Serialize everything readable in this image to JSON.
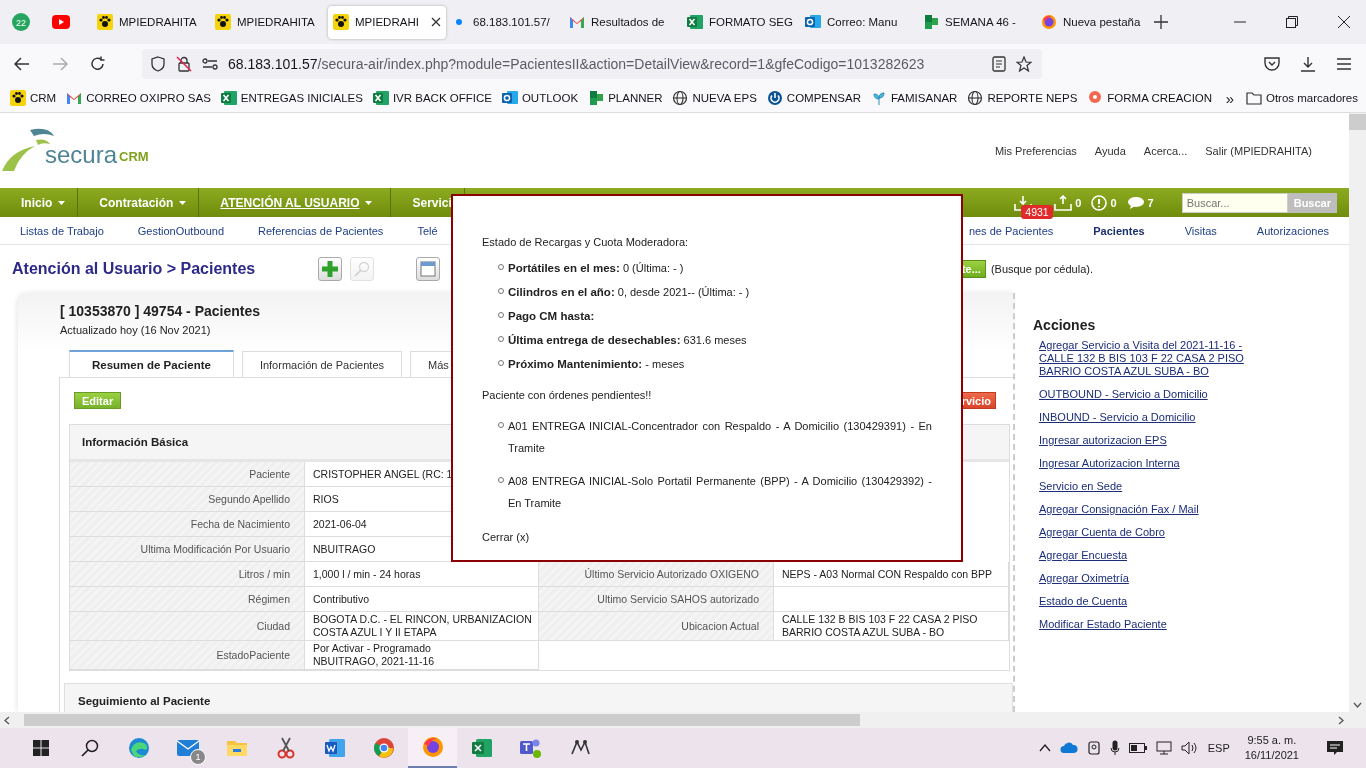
{
  "browser": {
    "pinned_badge": "22",
    "tabs": [
      {
        "title": "MPIEDRAHITA",
        "selected": false
      },
      {
        "title": "MPIEDRAHITA",
        "selected": false
      },
      {
        "title": "MPIEDRAHI",
        "selected": true
      },
      {
        "title": "68.183.101.57/",
        "selected": false
      },
      {
        "title": "Resultados de",
        "selected": false
      },
      {
        "title": "FORMATO SEG",
        "selected": false
      },
      {
        "title": "Correo: Manu",
        "selected": false
      },
      {
        "title": "SEMANA 46 -",
        "selected": false
      },
      {
        "title": "Nueva pestaña",
        "selected": false
      }
    ],
    "url_host": "68.183.101.57",
    "url_path": "/secura-air/index.php?module=PacientesII&action=DetailView&record=1&gfeCodigo=1013282623",
    "bookmarks": [
      "CRM",
      "CORREO OXIPRO SAS",
      "ENTREGAS INICIALES",
      "IVR BACK OFFICE",
      "OUTLOOK",
      "PLANNER",
      "NUEVA EPS",
      "COMPENSAR",
      "FAMISANAR",
      "REPORTE NEPS",
      "FORMA CREACION"
    ],
    "bookmarks_more": "»",
    "other_bookmarks": "Otros marcadores"
  },
  "header": {
    "logo": "secura",
    "logo_suffix": "CRM",
    "links": [
      "Mis Preferencias",
      "Ayuda",
      "Acerca...",
      "Salir (MPIEDRAHITA)"
    ]
  },
  "main_menu": [
    {
      "label": "Inicio",
      "selected": false
    },
    {
      "label": "Contratación",
      "selected": false
    },
    {
      "label": "ATENCIÓN AL USUARIO",
      "selected": true
    },
    {
      "label": "Servici",
      "selected": false
    }
  ],
  "notifications": {
    "badge": "4931",
    "counts": [
      "0",
      "0",
      "7"
    ]
  },
  "search": {
    "placeholder": "Buscar...",
    "button": "Buscar"
  },
  "sub_menu_left": [
    {
      "label": "Listas de Trabajo",
      "selected": false
    },
    {
      "label": "GestionOutbound",
      "selected": false
    },
    {
      "label": "Referencias de Pacientes",
      "selected": false
    },
    {
      "label": "Telé",
      "selected": false
    }
  ],
  "sub_menu_right": [
    {
      "label": "nes de Pacientes",
      "selected": false
    },
    {
      "label": "Pacientes",
      "selected": true
    },
    {
      "label": "Visitas",
      "selected": false
    },
    {
      "label": "Autorizaciones",
      "selected": false
    }
  ],
  "breadcrumb": "Atención al Usuario > Pacientes",
  "lookup": {
    "button": "te...",
    "hint": "(Busque por cédula)."
  },
  "record": {
    "title": "[ 10353870 ] 49754 - Pacientes",
    "updated": "Actualizado hoy (16 Nov 2021)"
  },
  "tabs": [
    {
      "label": "Resumen de Paciente",
      "selected": true
    },
    {
      "label": "Información de Pacientes",
      "selected": false
    },
    {
      "label": "Más",
      "selected": false
    }
  ],
  "edit_button": "Editar",
  "service_button": "rvicio",
  "basic_info": {
    "title": "Información Básica",
    "rows": [
      {
        "label": "Paciente",
        "value": "CRISTOPHER ANGEL (RC: 1"
      },
      {
        "label": "Segundo Apellido",
        "value": "RIOS"
      },
      {
        "label": "Fecha de Nacimiento",
        "value": "2021-06-04"
      },
      {
        "label": "Ultima Modificación Por Usuario",
        "value": "NBUITRAGO"
      },
      {
        "label": "Litros / min",
        "value": "1,000 l / min - 24 horas",
        "label_2": "Último Servicio Autorizado OXIGENO",
        "value_2": "NEPS - A03 Normal CON Respaldo con BPP"
      },
      {
        "label": "Régimen",
        "value": "Contributivo",
        "label_2": "Ultimo Servicio SAHOS autorizado"
      },
      {
        "label": "Ciudad",
        "value": "BOGOTA D.C. - EL RINCON, URBANIZACION COSTA AZUL I Y II ETAPA",
        "label_2": "Ubicacion Actual",
        "value_2": "CALLE 132 B BIS 103 F 22 CASA 2 PISO BARRIO COSTA AZUL SUBA - BO"
      },
      {
        "label": "EstadoPaciente",
        "value": "Por Activar - Programado",
        "note": "NBUITRAGO, 2021-11-16"
      }
    ]
  },
  "followup": {
    "title": "Seguimiento al Paciente"
  },
  "actions": {
    "title": "Acciones",
    "links": [
      "Agregar Servicio a Visita del 2021-11-16 - CALLE 132 B BIS 103 F 22 CASA 2 PISO BARRIO COSTA AZUL SUBA - BO",
      "OUTBOUND - Servicio a Domicilio",
      "INBOUND - Servicio a Domicilio",
      "Ingresar autorizacion EPS",
      "Ingresar Autorizacion Interna",
      "Servicio en Sede",
      "Agregar Consignación Fax / Mail",
      "Agregar Cuenta de Cobro",
      "Agregar Encuesta",
      "Agregar Oximetría",
      "Estado de Cuenta",
      "Modificar Estado Paciente"
    ]
  },
  "dialog": {
    "heading": "Estado de Recargas y Cuota Moderadora:",
    "items": [
      "**Portátiles en el mes:** 0 (Última: - )",
      "**Cilindros en el año:** 0, desde 2021-- (Última: - )",
      "**Pago CM hasta:**",
      "**Última entrega de desechables:** 631.6 meses",
      "**Próximo Mantenimiento:** - meses"
    ],
    "orders_heading": "Paciente con órdenes pendientes!!",
    "orders": [
      "A01 ENTREGA INICIAL-Concentrador con Respaldo - A Domicilio (130429391) - En Tramite",
      "A08 ENTREGA INICIAL-Solo Portatil Permanente (BPP) - A Domicilio (130429392) - En Tramite"
    ],
    "close": "Cerrar (x)"
  },
  "taskbar": {
    "mail_badge": "1",
    "language": "ESP",
    "time": "9:55 a. m.",
    "date": "16/11/2021"
  }
}
